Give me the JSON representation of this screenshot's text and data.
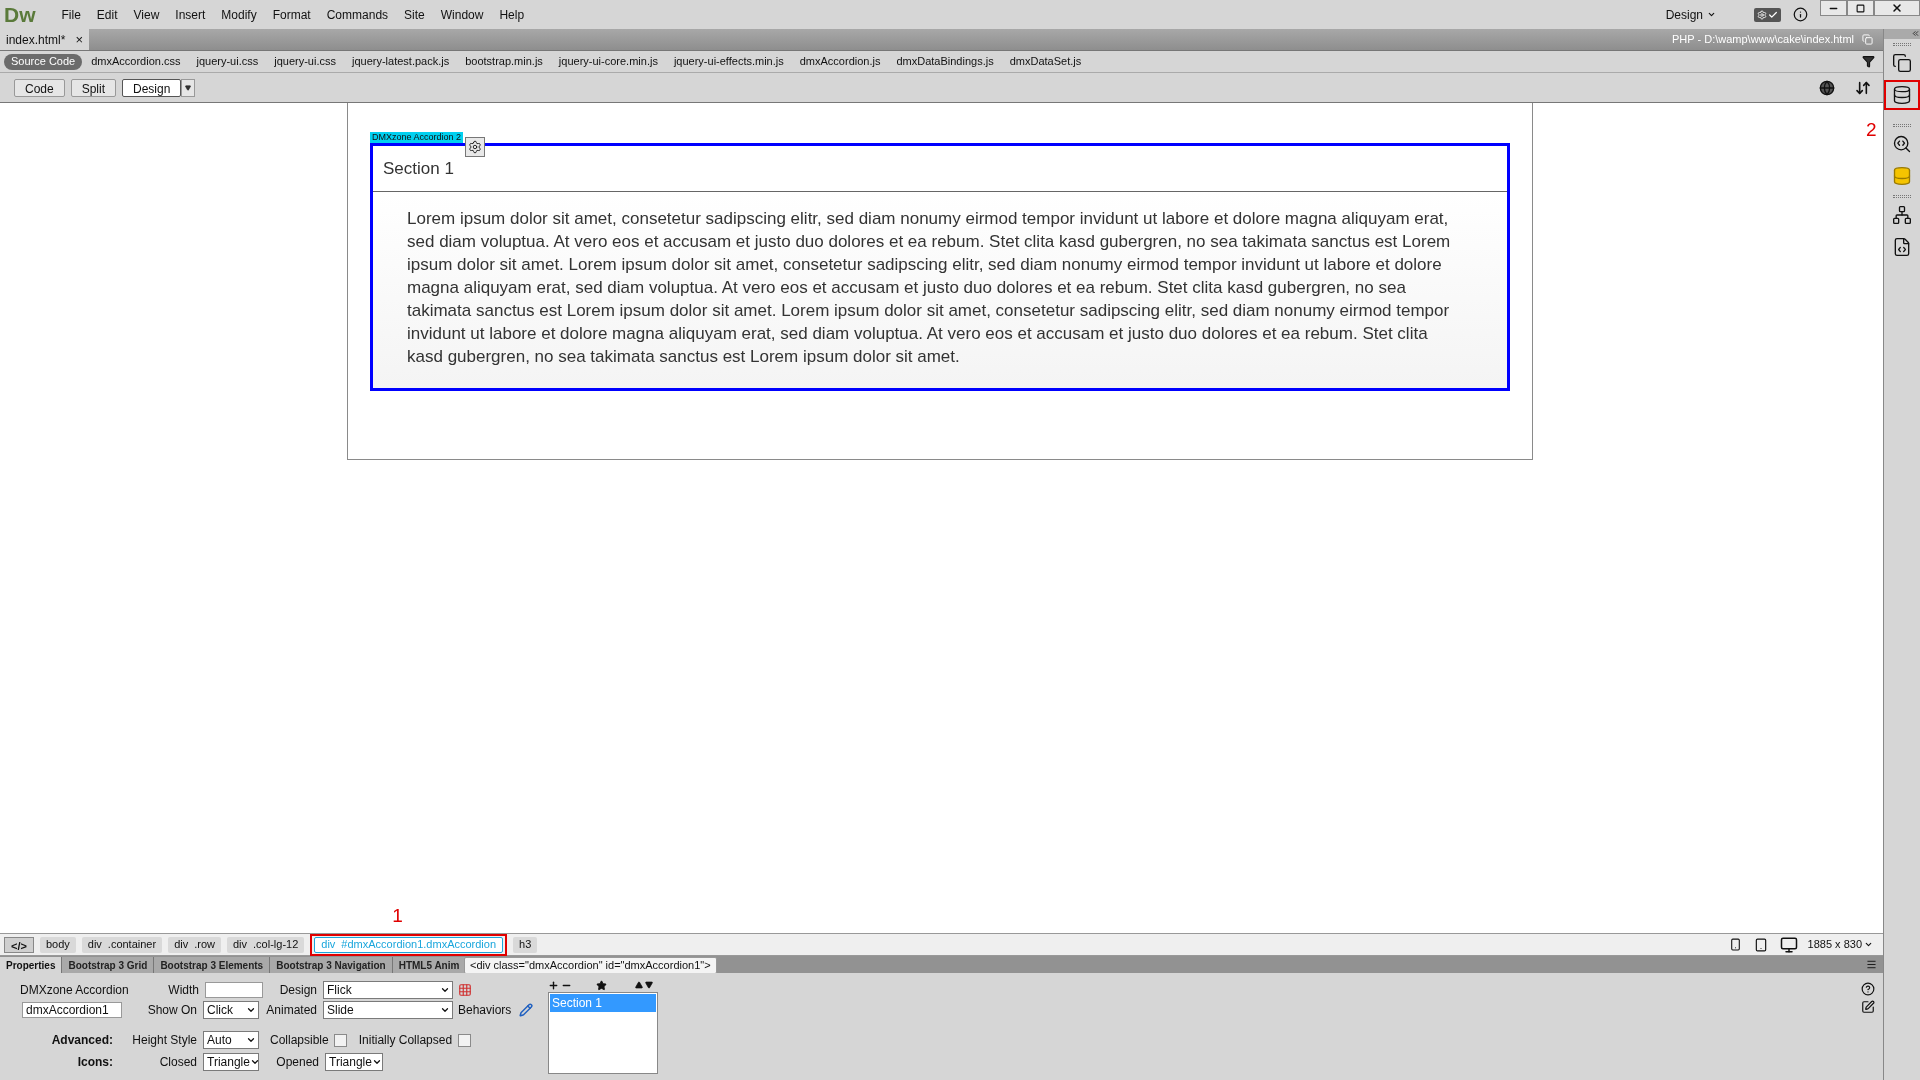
{
  "menu": {
    "logo": "Dw",
    "items": [
      "File",
      "Edit",
      "View",
      "Insert",
      "Modify",
      "Format",
      "Commands",
      "Site",
      "Window",
      "Help"
    ],
    "workspace": "Design"
  },
  "document_tabs": [
    {
      "label": "index.html*",
      "selected": true,
      "close": "×"
    }
  ],
  "file_path": "PHP - D:\\wamp\\www\\cake\\index.html",
  "related_files": [
    {
      "label": "Source Code",
      "selected": true
    },
    {
      "label": "dmxAccordion.css",
      "selected": false
    },
    {
      "label": "jquery-ui.css",
      "selected": false
    },
    {
      "label": "jquery-ui.css",
      "selected": false
    },
    {
      "label": "jquery-latest.pack.js",
      "selected": false
    },
    {
      "label": "bootstrap.min.js",
      "selected": false
    },
    {
      "label": "jquery-ui-core.min.js",
      "selected": false
    },
    {
      "label": "jquery-ui-effects.min.js",
      "selected": false
    },
    {
      "label": "dmxAccordion.js",
      "selected": false
    },
    {
      "label": "dmxDataBindings.js",
      "selected": false
    },
    {
      "label": "dmxDataSet.js",
      "selected": false
    }
  ],
  "view_buttons": [
    {
      "label": "Code",
      "selected": false
    },
    {
      "label": "Split",
      "selected": false
    },
    {
      "label": "Design",
      "selected": true
    }
  ],
  "accordion": {
    "tag_label": "DMXzone Accordion 2",
    "sections": [
      {
        "title": "Section 1",
        "expanded": true,
        "body": "Lorem ipsum dolor sit amet, consetetur sadipscing elitr, sed diam nonumy eirmod tempor invidunt ut labore et dolore magna aliquyam erat, sed diam voluptua. At vero eos et accusam et justo duo dolores et ea rebum. Stet clita kasd gubergren, no sea takimata sanctus est Lorem ipsum dolor sit amet. Lorem ipsum dolor sit amet, consetetur sadipscing elitr, sed diam nonumy eirmod tempor invidunt ut labore et dolore magna aliquyam erat, sed diam voluptua. At vero eos et accusam et justo duo dolores et ea rebum. Stet clita kasd gubergren, no sea takimata sanctus est Lorem ipsum dolor sit amet. Lorem ipsum dolor sit amet, consetetur sadipscing elitr, sed diam nonumy eirmod tempor invidunt ut labore et dolore magna aliquyam erat, sed diam voluptua. At vero eos et accusam et justo duo dolores et ea rebum. Stet clita kasd gubergren, no sea takimata sanctus est Lorem ipsum dolor sit amet."
      }
    ]
  },
  "tag_selector": {
    "code_label": "</>",
    "tags": [
      {
        "tag": "body",
        "selected": false
      },
      {
        "tag": "div",
        "selector": ".container",
        "selected": false
      },
      {
        "tag": "div",
        "selector": ".row",
        "selected": false
      },
      {
        "tag": "div",
        "selector": ".col-lg-12",
        "selected": false
      },
      {
        "tag": "div",
        "selector": "#dmxAccordion1.dmxAccordion",
        "selected": true,
        "callout": "1"
      },
      {
        "tag": "h3",
        "selected": false
      }
    ],
    "tooltip": "<div class=\"dmxAccordion\" id=\"dmxAccordion1\">",
    "size": "1885 x 830"
  },
  "panel_tabs": [
    {
      "label": "Properties",
      "selected": true
    },
    {
      "label": "Bootstrap 3 Grid",
      "selected": false
    },
    {
      "label": "Bootstrap 3 Elements",
      "selected": false
    },
    {
      "label": "Bootstrap 3 Navigation",
      "selected": false
    },
    {
      "label": "HTML5 Anim",
      "selected": false
    }
  ],
  "properties": {
    "title": "DMXzone Accordion",
    "id_value": "dmxAccordion1",
    "advanced_label": "Advanced:",
    "icons_label": "Icons:",
    "width": {
      "label": "Width"
    },
    "design": {
      "label": "Design",
      "value": "Flick"
    },
    "show_on": {
      "label": "Show On",
      "value": "Click"
    },
    "animated": {
      "label": "Animated",
      "value": "Slide"
    },
    "behaviors": {
      "label": "Behaviors"
    },
    "height_style": {
      "label": "Height Style",
      "value": "Auto"
    },
    "collapsible": {
      "label": "Collapsible",
      "checked": false
    },
    "initially_collapsed": {
      "label": "Initially Collapsed",
      "checked": false
    },
    "closed": {
      "label": "Closed",
      "value": "Triangle"
    },
    "opened": {
      "label": "Opened",
      "value": "Triangle"
    },
    "sections": [
      {
        "label": "Section 1",
        "selected": true
      }
    ]
  },
  "panel_icons": [
    {
      "kind": "assets"
    },
    {
      "kind": "bindings",
      "callout": "2"
    },
    {
      "kind": "code-search"
    },
    {
      "kind": "cylinders"
    },
    {
      "kind": "sitemap"
    },
    {
      "kind": "code-file"
    }
  ]
}
